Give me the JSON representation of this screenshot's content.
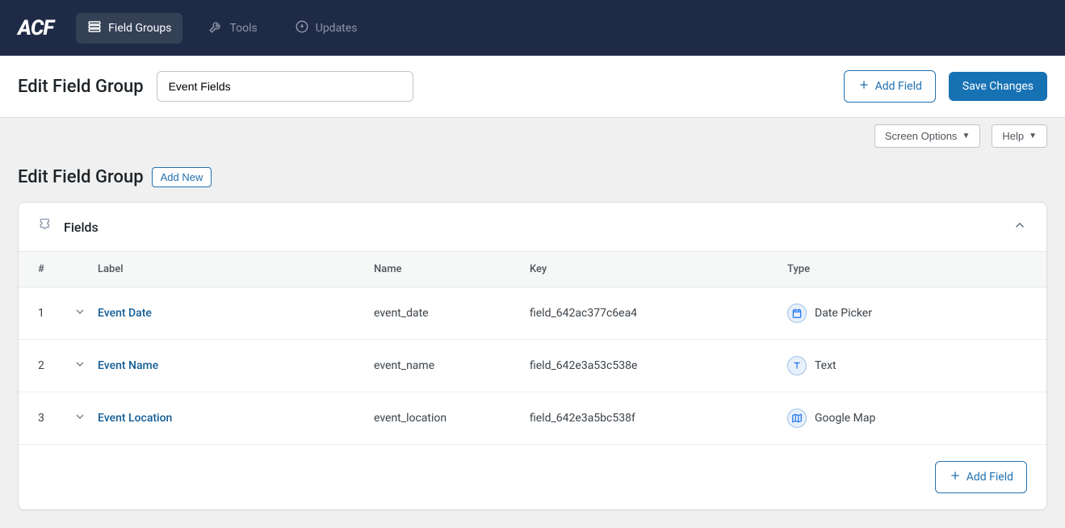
{
  "nav": {
    "logo": "ACF",
    "items": [
      {
        "label": "Field Groups",
        "active": true
      },
      {
        "label": "Tools",
        "active": false
      },
      {
        "label": "Updates",
        "active": false
      }
    ]
  },
  "header": {
    "page_title": "Edit Field Group",
    "group_name": "Event Fields",
    "add_field_label": "Add Field",
    "save_label": "Save Changes"
  },
  "toolbar": {
    "screen_options": "Screen Options",
    "help": "Help"
  },
  "subheader": {
    "title": "Edit Field Group",
    "add_new": "Add New"
  },
  "panel": {
    "title": "Fields",
    "columns": {
      "num": "#",
      "label": "Label",
      "name": "Name",
      "key": "Key",
      "type": "Type"
    },
    "rows": [
      {
        "num": "1",
        "label": "Event Date",
        "name": "event_date",
        "key": "field_642ac377c6ea4",
        "type": "Date Picker",
        "icon": "calendar"
      },
      {
        "num": "2",
        "label": "Event Name",
        "name": "event_name",
        "key": "field_642e3a53c538e",
        "type": "Text",
        "icon": "text"
      },
      {
        "num": "3",
        "label": "Event Location",
        "name": "event_location",
        "key": "field_642e3a5bc538f",
        "type": "Google Map",
        "icon": "map"
      }
    ],
    "add_field_label": "Add Field"
  }
}
